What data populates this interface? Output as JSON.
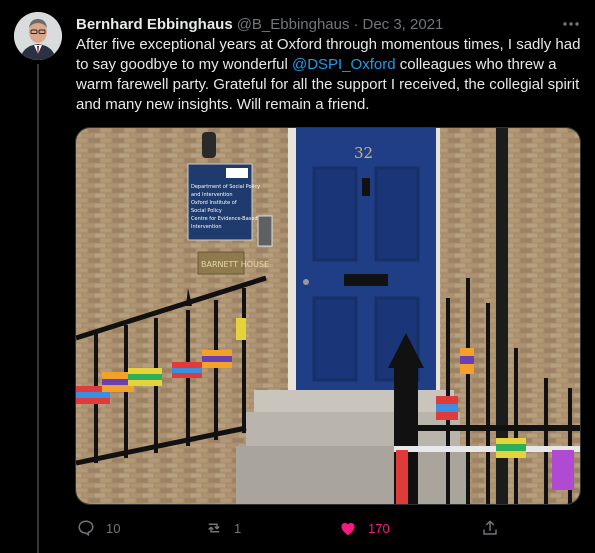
{
  "author": {
    "name": "Bernhard Ebbinghaus",
    "handle": "@B_Ebbinghaus",
    "separator": "·",
    "date": "Dec 3, 2021"
  },
  "tweet": {
    "text_before": "After five exceptional years at Oxford through momentous times, I sadly had to say goodbye to my wonderful ",
    "mention": "@DSPI_Oxford",
    "text_after": " colleagues who threw a warm farewell party. Grateful for all the support I received, the collegial spirit and many new insights. Will remain a friend."
  },
  "media": {
    "door_number": "32",
    "sign_lines": [
      "Department of Social Policy",
      "and Intervention",
      "Oxford Institute of",
      "Social Policy",
      "Centre for Evidence-Based",
      "Intervention"
    ],
    "plaque_text": "BARNETT HOUSE"
  },
  "actions": {
    "reply_count": "10",
    "retweet_count": "1",
    "like_count": "170",
    "like_color": "#f91880",
    "icons": [
      "reply-icon",
      "retweet-icon",
      "heart-icon",
      "share-icon"
    ]
  }
}
